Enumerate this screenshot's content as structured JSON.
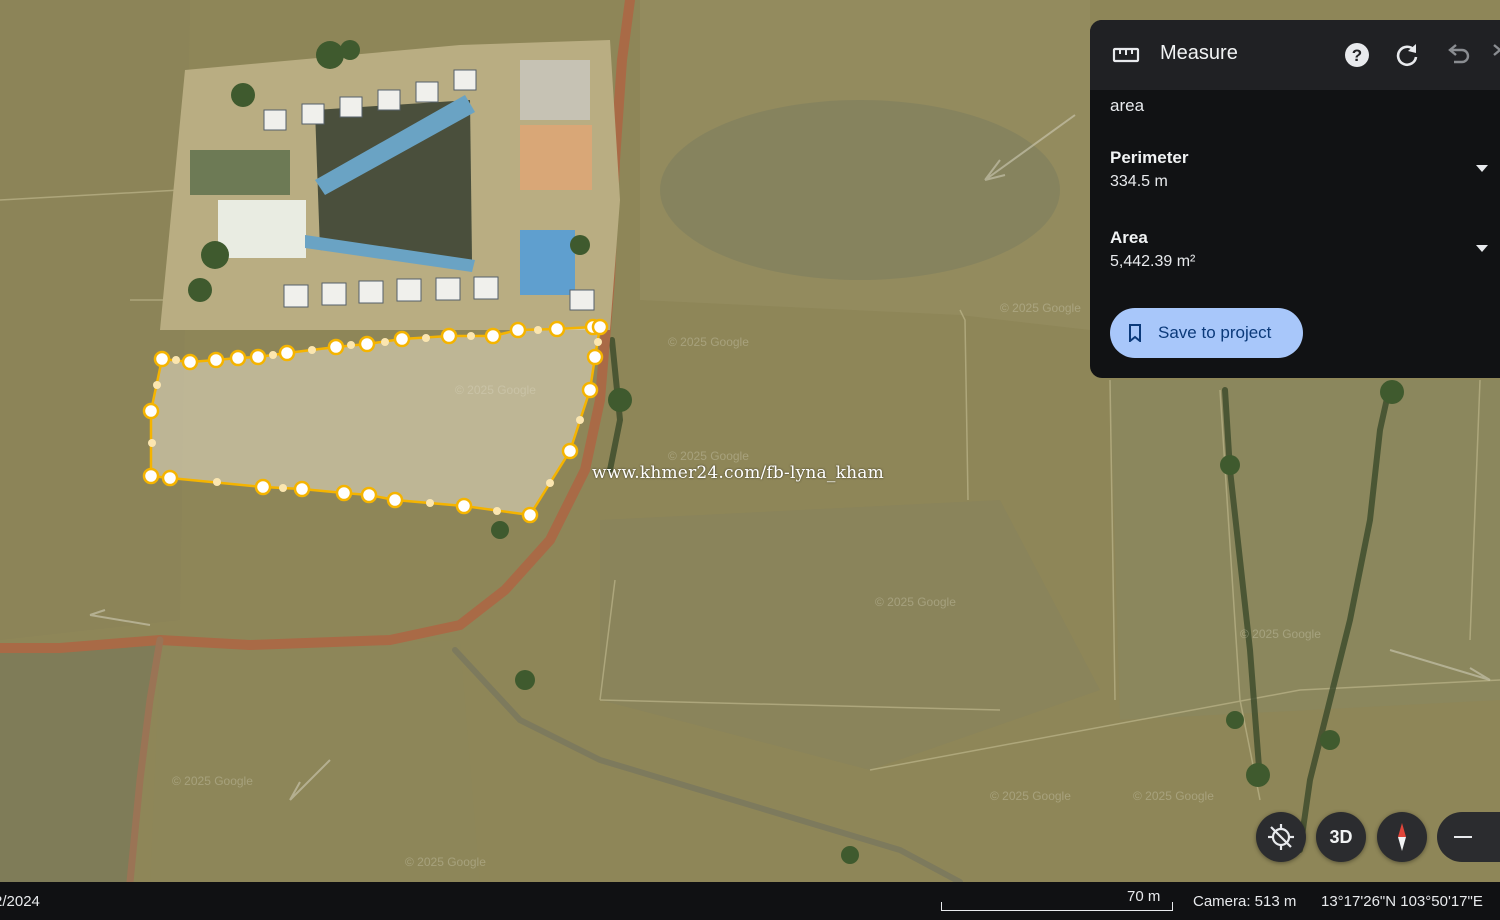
{
  "measure_panel": {
    "title": "Measure",
    "mode": "area",
    "perimeter": {
      "label": "Perimeter",
      "value": "334.5 m"
    },
    "area": {
      "label": "Area",
      "value": "5,442.39 m²"
    },
    "save_label": "Save to project",
    "icons": [
      "ruler-icon",
      "help-icon",
      "refresh-icon",
      "undo-icon",
      "redo-icon",
      "chevron-down-icon",
      "bookmark-icon"
    ]
  },
  "map": {
    "watermark": "www.khmer24.com/fb-lyna_kham",
    "imagery_credit": "© 2025 Google",
    "measured_polygon_color": "#f5b400"
  },
  "map_controls": {
    "three_d_label": "3D",
    "icons": [
      "location-off-icon",
      "compass-icon",
      "zoom-out-icon"
    ]
  },
  "status_bar": {
    "date": "2/2024",
    "scale": "70 m",
    "camera": "Camera: 513 m",
    "coordinates": "13°17'26\"N 103°50'17\"E"
  }
}
